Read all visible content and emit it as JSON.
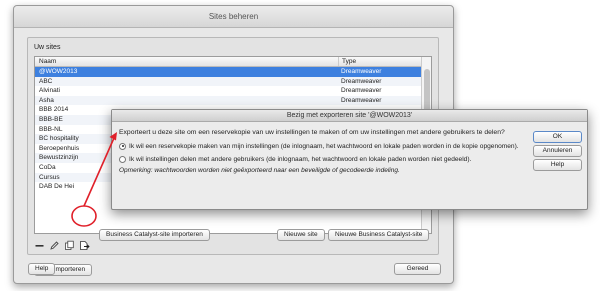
{
  "window": {
    "title": "Sites beheren",
    "group_label": "Uw sites",
    "columns": {
      "name": "Naam",
      "type": "Type"
    },
    "sites": [
      {
        "name": "@WOW2013",
        "type": "Dreamweaver",
        "selected": true
      },
      {
        "name": "ABC",
        "type": "Dreamweaver"
      },
      {
        "name": "Alvinati",
        "type": "Dreamweaver"
      },
      {
        "name": "Asha",
        "type": "Dreamweaver"
      },
      {
        "name": "BBB 2014",
        "type": ""
      },
      {
        "name": "BBB-BE",
        "type": ""
      },
      {
        "name": "BBB-NL",
        "type": ""
      },
      {
        "name": "BC hospitality",
        "type": ""
      },
      {
        "name": "Beroepenhuis",
        "type": ""
      },
      {
        "name": "Bewustzinzijn",
        "type": ""
      },
      {
        "name": "CoDa",
        "type": ""
      },
      {
        "name": "Cursus",
        "type": ""
      },
      {
        "name": "DAB De Hei",
        "type": ""
      }
    ],
    "buttons": {
      "import_site": "Site importeren",
      "import_bc": "Business Catalyst-site importeren",
      "new_site": "Nieuwe site",
      "new_bc": "Nieuwe Business Catalyst-site",
      "help": "Help",
      "done": "Gereed"
    },
    "tool_icons": [
      "minus-icon",
      "pencil-icon",
      "duplicate-icon",
      "export-icon"
    ]
  },
  "dialog": {
    "title": "Bezig met exporteren site '@WOW2013'",
    "question": "Exporteert u deze site om een reservekopie van uw instellingen te maken of om uw instellingen met andere gebruikers te delen?",
    "option_backup": "Ik wil een reservekopie maken van mijn instellingen (de inlognaam, het wachtwoord en lokale paden worden in de kopie opgenomen).",
    "option_share": "Ik wil instellingen delen met andere gebruikers (de inlognaam, het wachtwoord en lokale paden worden niet gedeeld).",
    "note": "Opmerking: wachtwoorden worden niet geëxporteerd naar een beveiligde of gecodeerde indeling.",
    "selected_option": "backup",
    "buttons": {
      "ok": "OK",
      "cancel": "Annuleren",
      "help": "Help"
    }
  },
  "colors": {
    "selection": "#3d80df",
    "annotation": "#e0202a"
  }
}
